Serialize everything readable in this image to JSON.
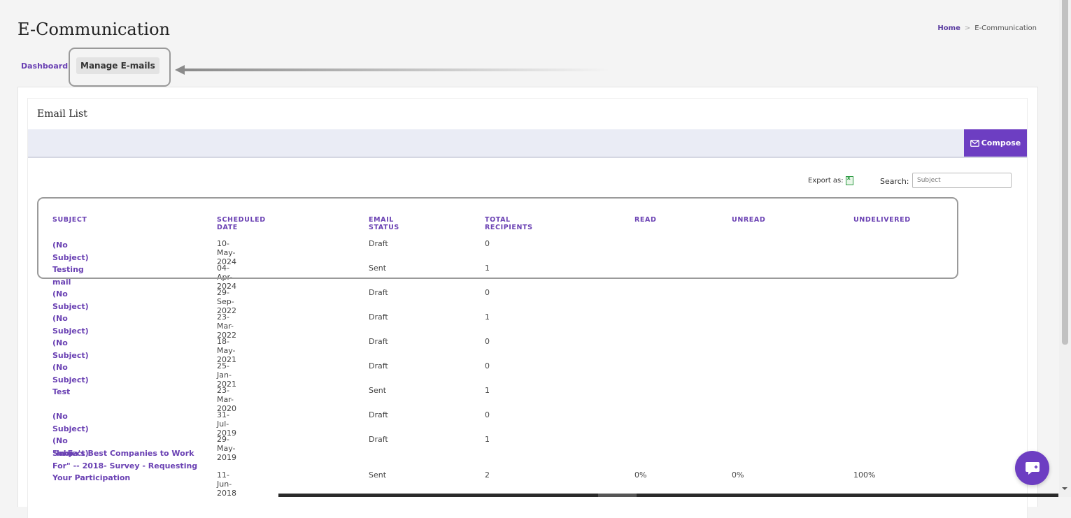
{
  "page": {
    "title": "E-Communication",
    "breadcrumb": {
      "home": "Home",
      "separator": ">",
      "current": "E-Communication"
    }
  },
  "subnav": {
    "dashboard": "Dashboard",
    "manage": "Manage E-mails"
  },
  "card": {
    "title": "Email List",
    "compose_label": "Compose"
  },
  "tools": {
    "export_label": "Export as:",
    "search_label": "Search:",
    "search_placeholder": "Subject"
  },
  "table": {
    "headers": [
      "SUBJECT",
      "SCHEDULED DATE",
      "EMAIL STATUS",
      "TOTAL RECIPIENTS",
      "READ",
      "UNREAD",
      "UNDELIVERED"
    ],
    "rows": [
      {
        "subject": "(No Subject)",
        "date": "10-May-2024",
        "status": "Draft",
        "recipients": "0",
        "read": "",
        "unread": "",
        "undelivered": ""
      },
      {
        "subject": "Testing mail",
        "date": "04-Apr-2024",
        "status": "Sent",
        "recipients": "1",
        "read": "",
        "unread": "",
        "undelivered": ""
      },
      {
        "subject": "(No Subject)",
        "date": "29-Sep-2022",
        "status": "Draft",
        "recipients": "0",
        "read": "",
        "unread": "",
        "undelivered": ""
      },
      {
        "subject": "(No Subject)",
        "date": "23-Mar-2022",
        "status": "Draft",
        "recipients": "1",
        "read": "",
        "unread": "",
        "undelivered": ""
      },
      {
        "subject": "(No Subject)",
        "date": "18-May-2021",
        "status": "Draft",
        "recipients": "0",
        "read": "",
        "unread": "",
        "undelivered": ""
      },
      {
        "subject": "(No Subject)",
        "date": "25-Jan-2021",
        "status": "Draft",
        "recipients": "0",
        "read": "",
        "unread": "",
        "undelivered": ""
      },
      {
        "subject": "Test",
        "date": "23-Mar-2020",
        "status": "Sent",
        "recipients": "1",
        "read": "",
        "unread": "",
        "undelivered": ""
      },
      {
        "subject": "(No Subject)",
        "date": "31-Jul-2019",
        "status": "Draft",
        "recipients": "0",
        "read": "",
        "unread": "",
        "undelivered": ""
      },
      {
        "subject": "(No Subject)",
        "date": "29-May-2019",
        "status": "Draft",
        "recipients": "1",
        "read": "",
        "unread": "",
        "undelivered": ""
      },
      {
        "subject": "\"India's Best Companies to Work For\" -- 2018- Survey - Requesting Your Participation",
        "date": "11-Jun-2018",
        "status": "Sent",
        "recipients": "2",
        "read": "0%",
        "unread": "0%",
        "undelivered": "100%"
      }
    ]
  },
  "colors": {
    "accent": "#6d3ec2",
    "link": "#6a41b3",
    "band": "#eaecf5"
  },
  "icons": {
    "compose": "envelope-icon",
    "export": "excel-file-icon",
    "chat": "chat-bubble-icon"
  }
}
